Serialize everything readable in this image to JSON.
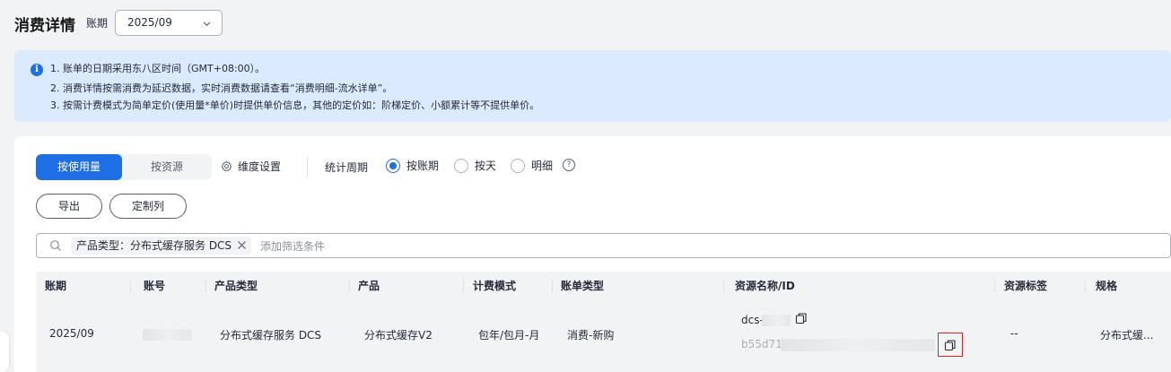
{
  "header": {
    "title": "消费详情",
    "period_label": "账期",
    "period_value": "2025/09"
  },
  "notice": {
    "lines": [
      "1. 账单的日期采用东八区时间（GMT+08:00）。",
      "2. 消费详情按需消费为延迟数据，实时消费数据请查看“消费明细-流水详单”。",
      "3. 按需计费模式为简单定价(使用量*单价)时提供单价信息，其他的定价如：阶梯定价、小额累计等不提供单价。"
    ]
  },
  "toolbar": {
    "tab_by_usage": "按使用量",
    "tab_by_resource": "按资源",
    "dimension_settings": "维度设置",
    "stat_period_label": "统计周期",
    "radio_by_period": "按账期",
    "radio_by_day": "按天",
    "radio_detail": "明细",
    "export_button": "导出",
    "custom_columns_button": "定制列"
  },
  "filter": {
    "chip_text": "产品类型：分布式缓存服务 DCS",
    "add_placeholder": "添加筛选条件"
  },
  "table": {
    "headers": [
      "账期",
      "账号",
      "产品类型",
      "产品",
      "计费模式",
      "账单类型",
      "资源名称/ID",
      "资源标签",
      "规格"
    ],
    "row": {
      "period": "2025/09",
      "product_type": "分布式缓存服务 DCS",
      "product": "分布式缓存V2",
      "billing_mode": "包年/包月-月",
      "bill_type": "消费-新购",
      "resource_name": "dcs-",
      "resource_id": "b55d71b",
      "resource_tags": "--",
      "spec": "分布式缓..."
    }
  },
  "colors": {
    "accent": "#1e6fe3",
    "notice_bg": "#dbeaff",
    "highlight": "#e02020"
  }
}
